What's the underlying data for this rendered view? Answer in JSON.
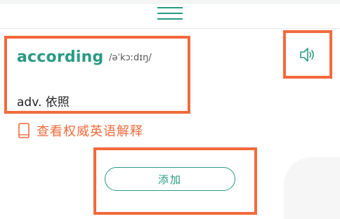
{
  "header": {
    "menu_icon": "hamburger-icon"
  },
  "word_card": {
    "word": "according",
    "phonetic": "/əˈkɔːdɪŋ/",
    "definition": "adv. 依照"
  },
  "speaker": {
    "icon": "speaker-icon"
  },
  "authority_link": {
    "icon": "book-icon",
    "label": "查看权威英语解释"
  },
  "add": {
    "label": "添加"
  },
  "colors": {
    "accent": "#2a9a84",
    "highlight": "#f26a3c"
  }
}
